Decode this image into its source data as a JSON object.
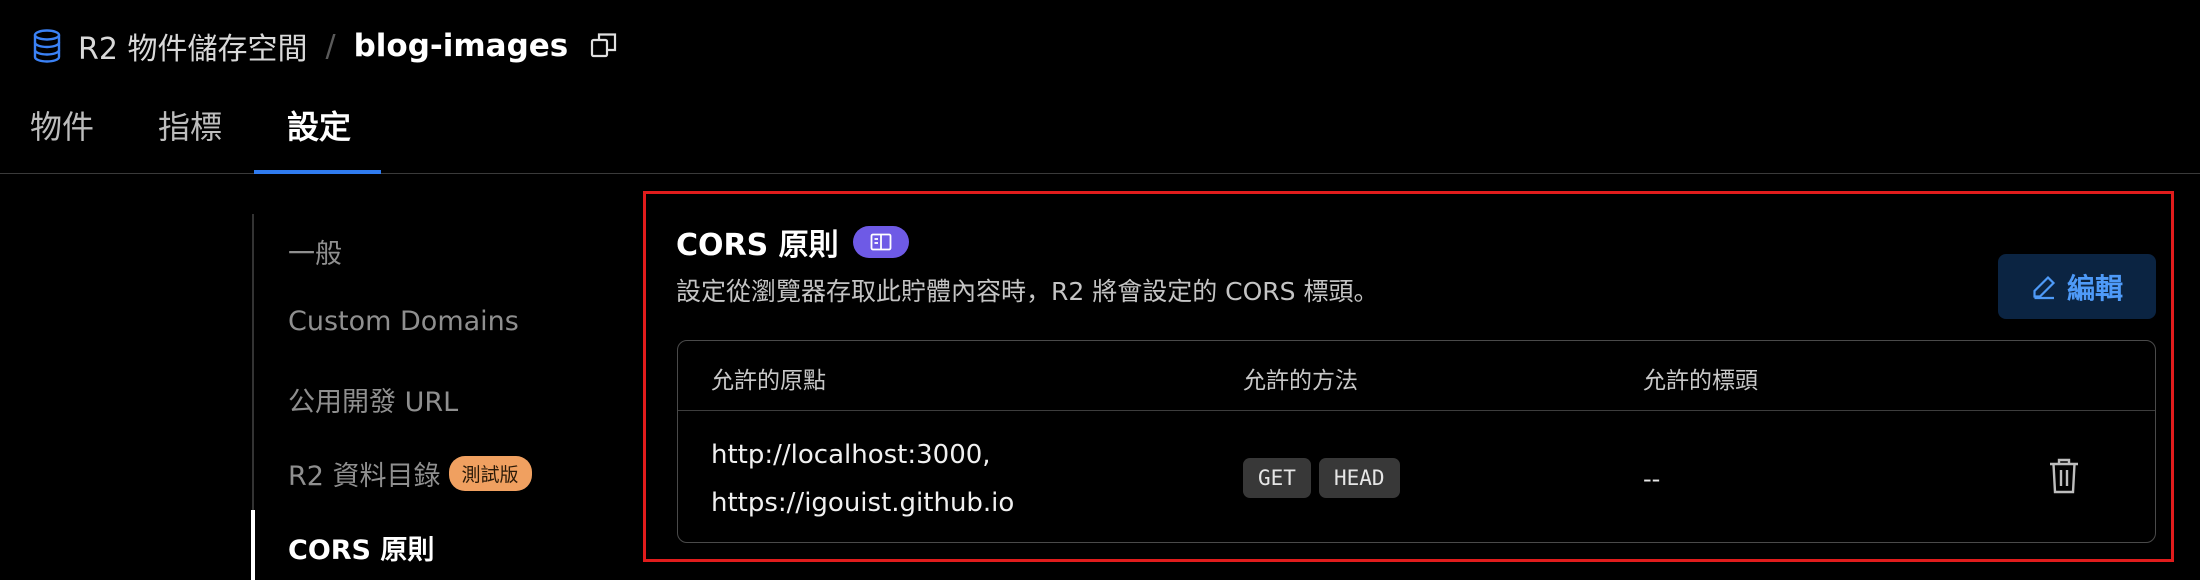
{
  "breadcrumb": {
    "parent": "R2 物件儲存空間",
    "separator": "/",
    "current": "blog-images"
  },
  "tabs": [
    {
      "label": "物件"
    },
    {
      "label": "指標"
    },
    {
      "label": "設定",
      "active": true
    }
  ],
  "side_nav": {
    "items": [
      {
        "label": "一般"
      },
      {
        "label": "Custom Domains"
      },
      {
        "label": "公用開發 URL"
      },
      {
        "label": "R2 資料目錄",
        "badge": "測試版"
      },
      {
        "label": "CORS 原則",
        "active": true
      }
    ]
  },
  "cors": {
    "title": "CORS 原則",
    "description": "設定從瀏覽器存取此貯體內容時，R2 將會設定的 CORS 標頭。",
    "edit_label": "編輯",
    "table": {
      "headers": [
        "允許的原點",
        "允許的方法",
        "允許的標頭"
      ],
      "row": {
        "origins": [
          "http://localhost:3000,",
          "https://igouist.github.io"
        ],
        "methods": [
          "GET",
          "HEAD"
        ],
        "headers": "--"
      }
    }
  },
  "icons": {
    "bucket": "database-icon",
    "copy": "copy-icon",
    "docs": "book-icon",
    "edit": "pencil-icon",
    "delete": "trash-icon"
  },
  "colors": {
    "accent": "#2f7bf0",
    "highlight_border": "#e01c1c",
    "badge_purple": "#6e5ae6",
    "beta_badge": "#f0a060",
    "edit_text": "#4e9af8"
  }
}
